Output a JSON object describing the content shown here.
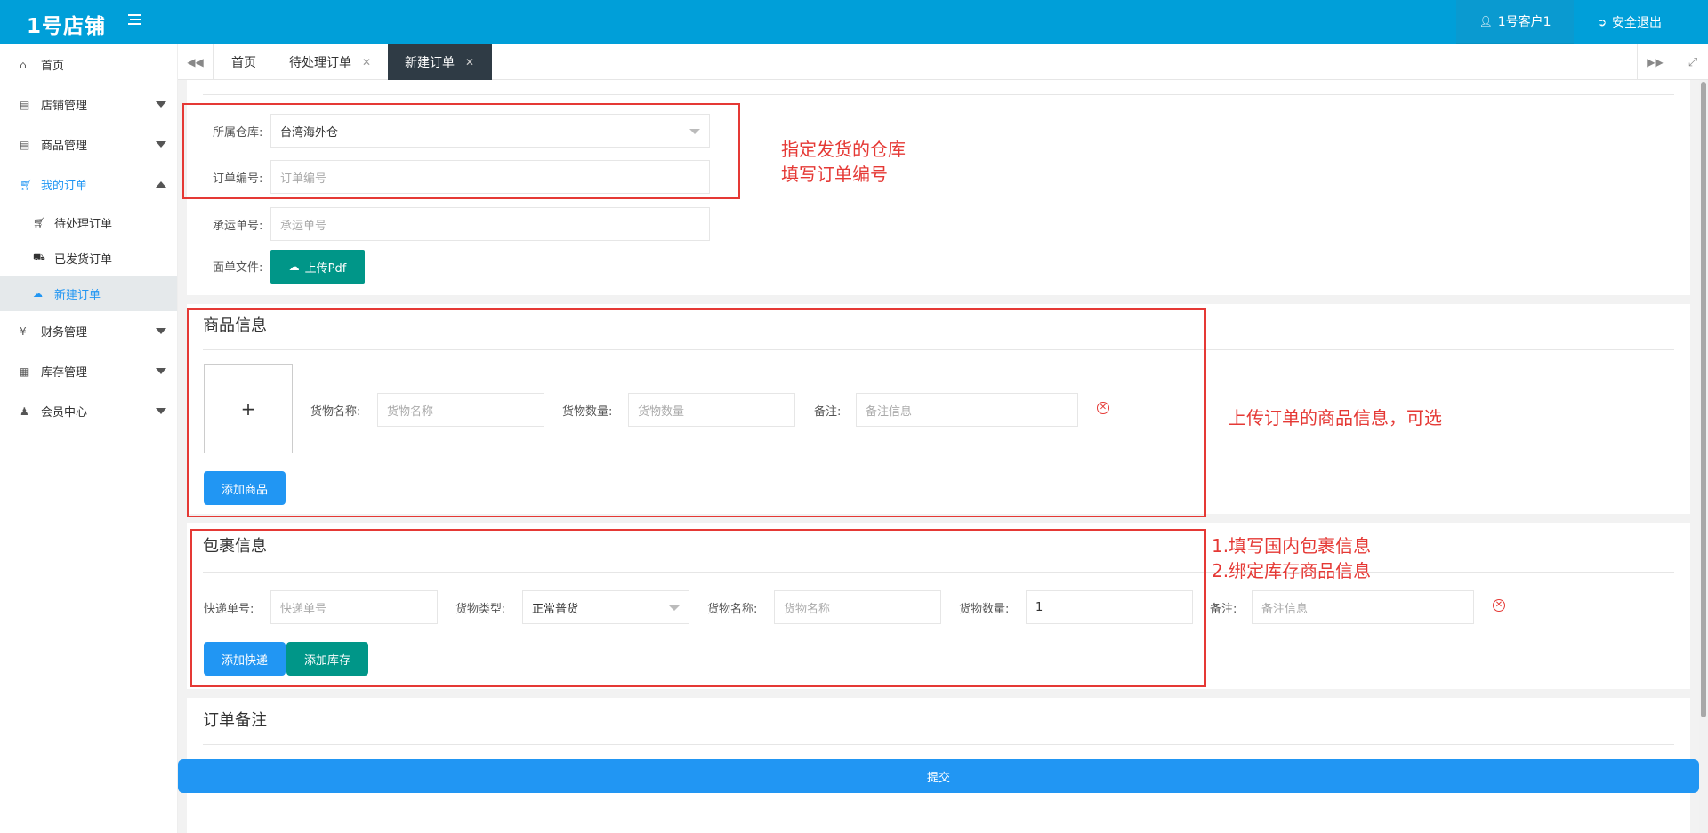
{
  "header": {
    "logo": "1号店铺",
    "user": "1号客户1",
    "logout": "安全退出"
  },
  "sidebar": {
    "items": [
      {
        "label": "首页",
        "icon": "home-icon"
      },
      {
        "label": "店铺管理",
        "icon": "shop-icon"
      },
      {
        "label": "商品管理",
        "icon": "goods-icon"
      },
      {
        "label": "我的订单",
        "icon": "cart-icon"
      },
      {
        "label": "财务管理",
        "icon": "yen-icon"
      },
      {
        "label": "库存管理",
        "icon": "table-icon"
      },
      {
        "label": "会员中心",
        "icon": "member-icon"
      }
    ],
    "sub": [
      {
        "label": "待处理订单",
        "icon": "cart-icon"
      },
      {
        "label": "已发货订单",
        "icon": "truck-icon"
      },
      {
        "label": "新建订单",
        "icon": "cloud-upload-icon"
      }
    ]
  },
  "tabs": [
    {
      "label": "首页"
    },
    {
      "label": "待处理订单"
    },
    {
      "label": "新建订单"
    }
  ],
  "basic": {
    "warehouse_label": "所属仓库:",
    "warehouse_value": "台湾海外仓",
    "order_no_label": "订单编号:",
    "order_no_placeholder": "订单编号",
    "tracking_label": "承运单号:",
    "tracking_placeholder": "承运单号",
    "file_label": "面单文件:",
    "upload_pdf": "上传Pdf"
  },
  "goods": {
    "title": "商品信息",
    "upload_plus": "+",
    "name_label": "货物名称:",
    "name_placeholder": "货物名称",
    "qty_label": "货物数量:",
    "qty_placeholder": "货物数量",
    "note_label": "备注:",
    "note_placeholder": "备注信息",
    "add_button": "添加商品"
  },
  "package": {
    "title": "包裹信息",
    "express_label": "快递单号:",
    "express_placeholder": "快递单号",
    "type_label": "货物类型:",
    "type_value": "正常普货",
    "name_label": "货物名称:",
    "name_placeholder": "货物名称",
    "qty_label": "货物数量:",
    "qty_value": "1",
    "note_label": "备注:",
    "note_placeholder": "备注信息",
    "add_express": "添加快递",
    "add_stock": "添加库存"
  },
  "remark": {
    "title": "订单备注"
  },
  "submit": "提交",
  "annotations": {
    "a1_line1": "指定发货的仓库",
    "a1_line2": "填写订单编号",
    "a2": "上传订单的商品信息，可选",
    "a3_line1": "1.填写国内包裹信息",
    "a3_line2": "2.绑定库存商品信息"
  },
  "colors": {
    "header": "#009fd9",
    "active_tab": "#2f3b45",
    "primary": "#2196f3",
    "green": "#009688",
    "annotation": "#e53935"
  }
}
